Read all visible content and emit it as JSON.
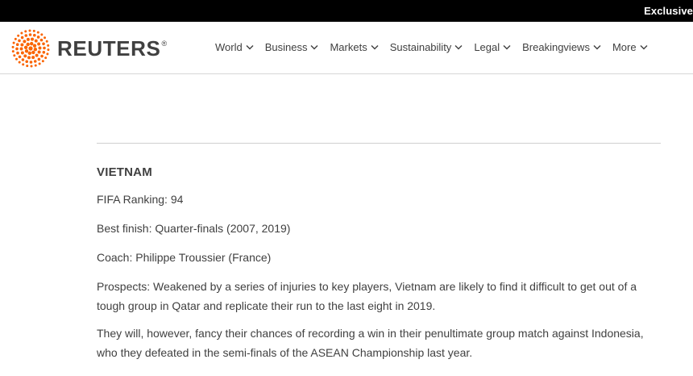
{
  "topbar": {
    "promo_label": "Exclusive"
  },
  "header": {
    "brand": "REUTERS",
    "brand_mark": "®",
    "brand_color": "#fa6400"
  },
  "nav": {
    "items": [
      {
        "label": "World"
      },
      {
        "label": "Business"
      },
      {
        "label": "Markets"
      },
      {
        "label": "Sustainability"
      },
      {
        "label": "Legal"
      },
      {
        "label": "Breakingviews"
      },
      {
        "label": "More"
      }
    ]
  },
  "article": {
    "heading": "VIETNAM",
    "fifa_ranking": "FIFA Ranking: 94",
    "best_finish": "Best finish: Quarter-finals (2007, 2019)",
    "coach": "Coach: Philippe Troussier (France)",
    "prospects": "Prospects: Weakened by a series of injuries to key players, Vietnam are likely to find it difficult to get out of a tough group in Qatar and replicate their run to the last eight in 2019.",
    "paragraph_2": "They will, however, fancy their chances of recording a win in their penultimate group match against Indonesia, who they defeated in the semi-finals of the ASEAN Championship last year."
  }
}
